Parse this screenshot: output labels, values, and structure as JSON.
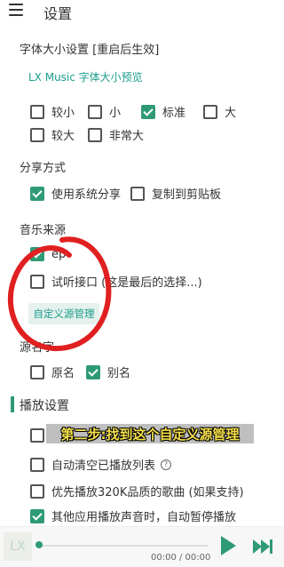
{
  "header": {
    "title": "设置"
  },
  "font_size": {
    "title": "字体大小设置 [重启后生效]",
    "preview": "LX Music 字体大小预览",
    "options": [
      {
        "label": "较小",
        "checked": false
      },
      {
        "label": "小",
        "checked": false
      },
      {
        "label": "标准",
        "checked": true
      },
      {
        "label": "大",
        "checked": false
      },
      {
        "label": "较大",
        "checked": false
      },
      {
        "label": "非常大",
        "checked": false
      }
    ]
  },
  "share": {
    "title": "分享方式",
    "options": [
      {
        "label": "使用系统分享",
        "checked": true
      },
      {
        "label": "复制到剪贴板",
        "checked": false
      }
    ]
  },
  "music_source": {
    "title": "音乐来源",
    "options": [
      {
        "label": "ep",
        "checked": true
      },
      {
        "label": "试听接口 (这是最后的选择...)",
        "checked": false
      }
    ],
    "custom_button": "自定义源管理"
  },
  "source_name": {
    "title": "源名字",
    "options": [
      {
        "label": "原名",
        "checked": false
      },
      {
        "label": "别名",
        "checked": true
      }
    ]
  },
  "playback": {
    "title": "播放设置",
    "options": [
      {
        "label": "",
        "checked": false
      },
      {
        "label": "自动清空已播放列表",
        "checked": false
      },
      {
        "label": "优先播放320K品质的歌曲 (如果支持)",
        "checked": false
      },
      {
        "label": "其他应用播放声音时，自动暂停播放",
        "checked": true
      }
    ]
  },
  "caption": "第二步:找到这个自定义源管理",
  "player": {
    "logo": "LX",
    "time": "00:00 / 00:00"
  },
  "colors": {
    "accent": "#2f9b76",
    "link": "#1a9c8c",
    "annotation": "#e02020",
    "caption": "#f5e04a"
  }
}
